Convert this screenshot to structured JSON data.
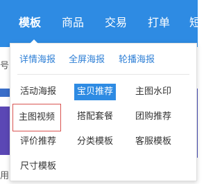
{
  "top_nav": {
    "items": [
      {
        "label": "模板",
        "active": true
      },
      {
        "label": "商品",
        "active": false
      },
      {
        "label": "交易",
        "active": false
      },
      {
        "label": "打单",
        "active": false
      },
      {
        "label": "短",
        "active": false
      }
    ]
  },
  "background": {
    "left_fragments": [
      "号",
      "用"
    ]
  },
  "dropdown": {
    "poster_links": [
      "详情海报",
      "全屏海报",
      "轮播海报"
    ],
    "templates": [
      {
        "label": "活动海报",
        "state": "normal"
      },
      {
        "label": "宝贝推荐",
        "state": "selected"
      },
      {
        "label": "主图水印",
        "state": "normal"
      },
      {
        "label": "主图视频",
        "state": "outlined"
      },
      {
        "label": "搭配套餐",
        "state": "normal"
      },
      {
        "label": "团购推荐",
        "state": "normal"
      },
      {
        "label": "评价推荐",
        "state": "normal"
      },
      {
        "label": "分类模板",
        "state": "normal"
      },
      {
        "label": "客服模板",
        "state": "normal"
      },
      {
        "label": "尺寸模板",
        "state": "normal"
      }
    ]
  },
  "colors": {
    "nav_bg": "#2e8be3",
    "link": "#2e7fd6",
    "selected_bg": "#2e8be3",
    "highlight_border": "#d9534f"
  }
}
